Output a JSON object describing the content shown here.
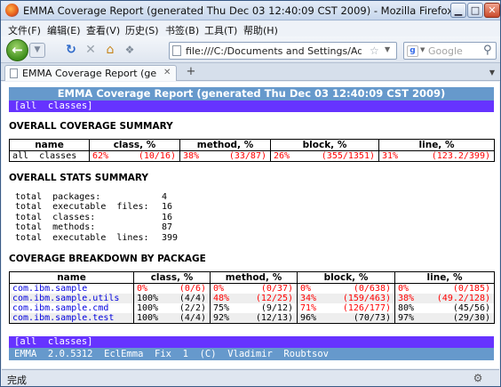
{
  "window": {
    "title": "EMMA Coverage Report (generated Thu Dec 03 12:40:09 CST 2009) - Mozilla Firefox",
    "min_glyph": "▁",
    "max_glyph": "□",
    "close_glyph": "✕"
  },
  "menu": [
    "文件(F)",
    "编辑(E)",
    "查看(V)",
    "历史(S)",
    "书签(B)",
    "工具(T)",
    "帮助(H)"
  ],
  "nav": {
    "url": "file:///C:/Documents and Settings/Administrator",
    "search_placeholder": "Google"
  },
  "tab": {
    "label": "EMMA Coverage Report (generat..."
  },
  "report": {
    "header_title": "EMMA Coverage Report (generated Thu Dec 03 12:40:09 CST 2009)",
    "all_classes_link": "[all  classes]",
    "overall_summary_heading": "OVERALL COVERAGE SUMMARY",
    "summary_headers": [
      "name",
      "class, %",
      "method, %",
      "block, %",
      "line, %"
    ],
    "summary_row": {
      "name": "all  classes",
      "class": {
        "pct": "62%",
        "frac": "(10/16)"
      },
      "method": {
        "pct": "38%",
        "frac": "(33/87)"
      },
      "block": {
        "pct": "26%",
        "frac": "(355/1351)"
      },
      "line": {
        "pct": "31%",
        "frac": "(123.2/399)"
      }
    },
    "stats_heading": "OVERALL STATS SUMMARY",
    "stats": [
      {
        "label": "total  packages:",
        "value": "4"
      },
      {
        "label": "total  executable  files:",
        "value": "16"
      },
      {
        "label": "total  classes:",
        "value": "16"
      },
      {
        "label": "total  methods:",
        "value": "87"
      },
      {
        "label": "total  executable  lines:",
        "value": "399"
      }
    ],
    "breakdown_heading": "COVERAGE BREAKDOWN BY PACKAGE",
    "breakdown_headers": [
      "name",
      "class, %",
      "method, %",
      "block, %",
      "line, %"
    ],
    "packages": [
      {
        "name": "com.ibm.sample",
        "class": [
          "0%",
          "(0/6)"
        ],
        "method": [
          "0%",
          "(0/37)"
        ],
        "block": [
          "0%",
          "(0/638)"
        ],
        "line": [
          "0%",
          "(0/185)"
        ]
      },
      {
        "name": "com.ibm.sample.utils",
        "class": [
          "100%",
          "(4/4)"
        ],
        "method": [
          "48%",
          "(12/25)"
        ],
        "block": [
          "34%",
          "(159/463)"
        ],
        "line": [
          "38%",
          "(49.2/128)"
        ]
      },
      {
        "name": "com.ibm.sample.cmd",
        "class": [
          "100%",
          "(2/2)"
        ],
        "method": [
          "75%",
          "(9/12)"
        ],
        "block": [
          "71%",
          "(126/177)"
        ],
        "line": [
          "80%",
          "(45/56)"
        ]
      },
      {
        "name": "com.ibm.sample.test",
        "class": [
          "100%",
          "(4/4)"
        ],
        "method": [
          "92%",
          "(12/13)"
        ],
        "block": [
          "96%",
          "(70/73)"
        ],
        "line": [
          "97%",
          "(29/30)"
        ]
      }
    ],
    "footer_link": "[all  classes]",
    "footer_version": "EMMA  2.0.5312  EclEmma  Fix  1  (C)  Vladimir  Roubtsov"
  },
  "status": {
    "text": "完成"
  },
  "colors": {
    "header_blue": "#6699cc",
    "link_bar_purple": "#6633ff",
    "low_coverage_red": "#ff0000",
    "package_link": "#0000dd"
  },
  "icons": [
    "firefox-icon",
    "back-arrow-icon",
    "forward-arrow-icon",
    "reload-icon",
    "stop-icon",
    "home-icon",
    "bookmark-icon",
    "page-icon",
    "star-icon",
    "google-icon",
    "search-magnifier-icon",
    "new-tab-plus-icon",
    "addon-icon"
  ]
}
